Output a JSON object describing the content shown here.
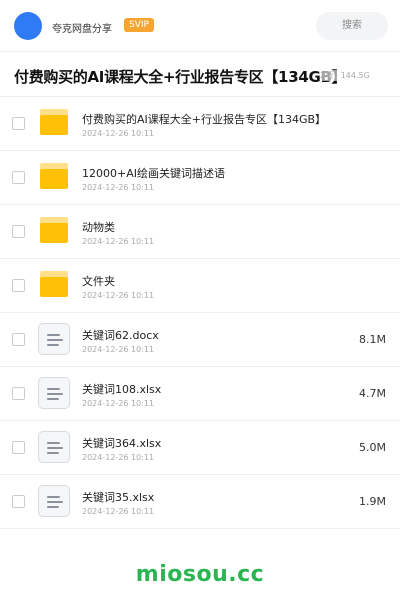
{
  "header": {
    "username": "夸克网盘分享",
    "badge": "SVIP",
    "search_label": "搜索"
  },
  "share": {
    "title": "付费购买的AI课程大全+行业报告专区【134GB】",
    "meta": "2项 · 144.5G"
  },
  "files": [
    {
      "name": "付费购买的AI课程大全+行业报告专区【134GB】",
      "date": "2024-12-26 10:11",
      "type": "folder",
      "size": ""
    },
    {
      "name": "12000+AI绘画关键词描述语",
      "date": "2024-12-26 10:11",
      "type": "folder",
      "size": ""
    },
    {
      "name": "动物类",
      "date": "2024-12-26 10:11",
      "type": "folder",
      "size": ""
    },
    {
      "name": "文件夹",
      "date": "2024-12-26 10:11",
      "type": "folder",
      "size": ""
    },
    {
      "name": "关键词62.docx",
      "date": "2024-12-26 10:11",
      "type": "doc",
      "size": "8.1M"
    },
    {
      "name": "关键词108.xlsx",
      "date": "2024-12-26 10:11",
      "type": "doc",
      "size": "4.7M"
    },
    {
      "name": "关键词364.xlsx",
      "date": "2024-12-26 10:11",
      "type": "doc",
      "size": "5.0M"
    },
    {
      "name": "关键词35.xlsx",
      "date": "2024-12-26 10:11",
      "type": "doc",
      "size": "1.9M"
    }
  ],
  "watermark": "miosou.cc",
  "colors": {
    "avatar": "#2f7bf5",
    "badge": "#f7a531",
    "folder": "#ffc107",
    "watermark": "#2bb552"
  }
}
